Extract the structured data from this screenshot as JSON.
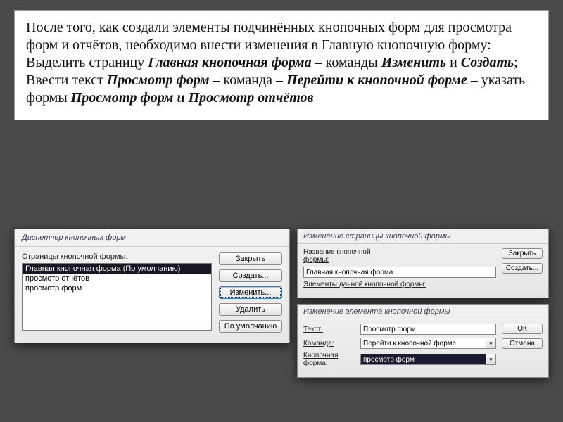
{
  "para": {
    "p1a": "После того, как создали элементы подчинённых кнопочных форм для просмотра форм и отчётов, необходимо внести изменения в Главную кнопочную форму:",
    "p2a": "Выделить страницу ",
    "p2b": "Главная кнопочная форма",
    "p2c": " – команды ",
    "p2d": "Изменить",
    "p2e": " и ",
    "p2f": "Создать",
    "p2g": ";",
    "p3a": "Ввести текст  ",
    "p3b": "Просмотр форм",
    "p3c": " – команда – ",
    "p3d": "Перейти к кнопочной форме",
    "p3e": " – указать формы ",
    "p3f": "Просмотр  форм и Просмотр отчётов"
  },
  "dlg1": {
    "title": "Диспетчер кнопочных форм",
    "pages_label": "Страницы кнопочной формы:",
    "items": [
      "Главная кнопочная форма (По умолчанию)",
      "просмотр отчётов",
      "просмотр форм"
    ],
    "btn_close": "Закрыть",
    "btn_new": "Создать...",
    "btn_edit": "Изменить...",
    "btn_delete": "Удалить",
    "btn_default": "По умолчанию"
  },
  "dlg2": {
    "title": "Изменение страницы кнопочной формы",
    "name_label": "Название кнопочной формы:",
    "name_value": "Главная кнопочная форма",
    "elements_label": "Элементы данной кнопочной формы:",
    "btn_close": "Закрыть",
    "btn_new": "Создать..."
  },
  "dlg3": {
    "title": "Изменение элемента кнопочной формы",
    "text_label": "Текст:",
    "text_value": "Просмотр форм",
    "cmd_label": "Команда:",
    "cmd_value": "Перейти к кнопочной форме",
    "form_label": "Кнопочная форма:",
    "form_value": "просмотр форм",
    "btn_ok": "ОК",
    "btn_cancel": "Отмена"
  }
}
